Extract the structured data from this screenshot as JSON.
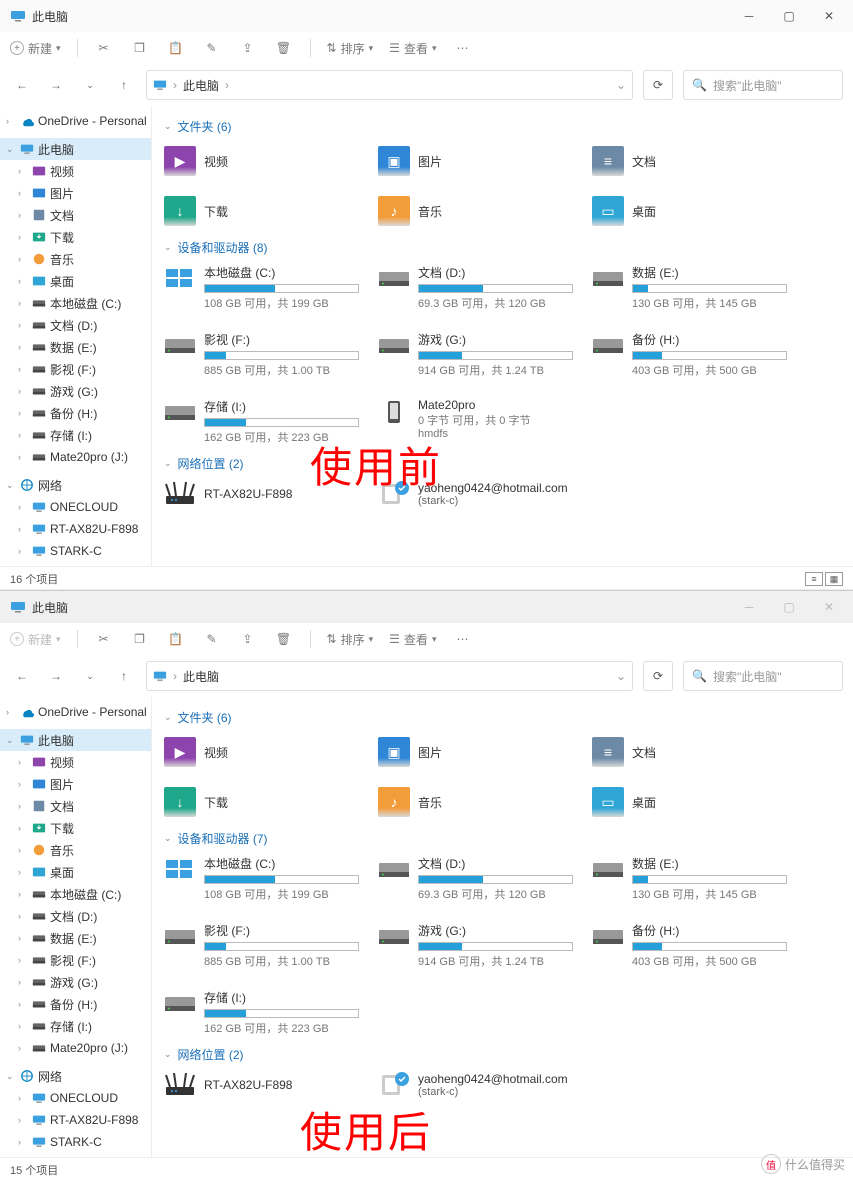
{
  "top": {
    "title": "此电脑",
    "new_btn": "新建",
    "sort_btn": "排序",
    "view_btn": "查看",
    "address": "此电脑",
    "search_ph": "搜索\"此电脑\"",
    "sidebar": {
      "onedrive": "OneDrive - Personal",
      "thispc": "此电脑",
      "items": [
        "视频",
        "图片",
        "文档",
        "下载",
        "音乐",
        "桌面",
        "本地磁盘 (C:)",
        "文档 (D:)",
        "数据 (E:)",
        "影视 (F:)",
        "游戏 (G:)",
        "备份 (H:)",
        "存储 (I:)",
        "Mate20pro (J:)"
      ],
      "network": "网络",
      "net_items": [
        "ONECLOUD",
        "RT-AX82U-F898",
        "STARK-C"
      ]
    },
    "folders_head": "文件夹 (6)",
    "folders": [
      {
        "n": "视频",
        "c": "#8e44ad",
        "g": "▶"
      },
      {
        "n": "图片",
        "c": "#2f86d6",
        "g": "▣"
      },
      {
        "n": "文档",
        "c": "#6c8aa5",
        "g": "≡"
      },
      {
        "n": "下载",
        "c": "#1ea78a",
        "g": "↓"
      },
      {
        "n": "音乐",
        "c": "#f39c3a",
        "g": "♪"
      },
      {
        "n": "桌面",
        "c": "#2fa6d6",
        "g": "▭"
      }
    ],
    "drives_head": "设备和驱动器 (8)",
    "drives": [
      {
        "n": "本地磁盘 (C:)",
        "s": "108 GB 可用，共 199 GB",
        "p": 46,
        "win": true
      },
      {
        "n": "文档 (D:)",
        "s": "69.3 GB 可用，共 120 GB",
        "p": 42
      },
      {
        "n": "数据 (E:)",
        "s": "130 GB 可用，共 145 GB",
        "p": 10
      },
      {
        "n": "影视 (F:)",
        "s": "885 GB 可用，共 1.00 TB",
        "p": 14
      },
      {
        "n": "游戏 (G:)",
        "s": "914 GB 可用，共 1.24 TB",
        "p": 28
      },
      {
        "n": "备份 (H:)",
        "s": "403 GB 可用，共 500 GB",
        "p": 19
      },
      {
        "n": "存储 (I:)",
        "s": "162 GB 可用，共 223 GB",
        "p": 27
      },
      {
        "n": "Mate20pro",
        "s": "0 字节 可用，共 0 字节",
        "s2": "hmdfs",
        "p": 0,
        "phone": true
      }
    ],
    "net_head": "网络位置 (2)",
    "net": [
      {
        "n": "RT-AX82U-F898",
        "router": true
      },
      {
        "n": "yaoheng0424@hotmail.com",
        "s": "(stark-c)",
        "media": true
      }
    ],
    "status": "16 个项目",
    "overlay": "使用前"
  },
  "bottom": {
    "title": "此电脑",
    "new_btn": "新建",
    "sort_btn": "排序",
    "view_btn": "查看",
    "address": "此电脑",
    "search_ph": "搜索\"此电脑\"",
    "sidebar": {
      "onedrive": "OneDrive - Personal",
      "thispc": "此电脑",
      "items": [
        "视频",
        "图片",
        "文档",
        "下载",
        "音乐",
        "桌面",
        "本地磁盘 (C:)",
        "文档 (D:)",
        "数据 (E:)",
        "影视 (F:)",
        "游戏 (G:)",
        "备份 (H:)",
        "存储 (I:)",
        "Mate20pro (J:)"
      ],
      "network": "网络",
      "net_items": [
        "ONECLOUD",
        "RT-AX82U-F898",
        "STARK-C"
      ]
    },
    "folders_head": "文件夹 (6)",
    "folders": [
      {
        "n": "视频",
        "c": "#8e44ad",
        "g": "▶"
      },
      {
        "n": "图片",
        "c": "#2f86d6",
        "g": "▣"
      },
      {
        "n": "文档",
        "c": "#6c8aa5",
        "g": "≡"
      },
      {
        "n": "下载",
        "c": "#1ea78a",
        "g": "↓"
      },
      {
        "n": "音乐",
        "c": "#f39c3a",
        "g": "♪"
      },
      {
        "n": "桌面",
        "c": "#2fa6d6",
        "g": "▭"
      }
    ],
    "drives_head": "设备和驱动器 (7)",
    "drives": [
      {
        "n": "本地磁盘 (C:)",
        "s": "108 GB 可用，共 199 GB",
        "p": 46,
        "win": true
      },
      {
        "n": "文档 (D:)",
        "s": "69.3 GB 可用，共 120 GB",
        "p": 42
      },
      {
        "n": "数据 (E:)",
        "s": "130 GB 可用，共 145 GB",
        "p": 10
      },
      {
        "n": "影视 (F:)",
        "s": "885 GB 可用，共 1.00 TB",
        "p": 14
      },
      {
        "n": "游戏 (G:)",
        "s": "914 GB 可用，共 1.24 TB",
        "p": 28
      },
      {
        "n": "备份 (H:)",
        "s": "403 GB 可用，共 500 GB",
        "p": 19
      },
      {
        "n": "存储 (I:)",
        "s": "162 GB 可用，共 223 GB",
        "p": 27
      }
    ],
    "net_head": "网络位置 (2)",
    "net": [
      {
        "n": "RT-AX82U-F898",
        "router": true
      },
      {
        "n": "yaoheng0424@hotmail.com",
        "s": "(stark-c)",
        "media": true
      }
    ],
    "status": "15 个项目",
    "overlay": "使用后",
    "watermark": "什么值得买"
  },
  "icons": {
    "colors": {
      "video": "#8e44ad",
      "image": "#2f86d6",
      "doc": "#6c8aa5",
      "dl": "#1ea78a",
      "music": "#f39c3a",
      "desktop": "#2fa6d6",
      "drive": "#888",
      "pc": "#0a84c2",
      "cloud": "#0a84c2"
    }
  }
}
